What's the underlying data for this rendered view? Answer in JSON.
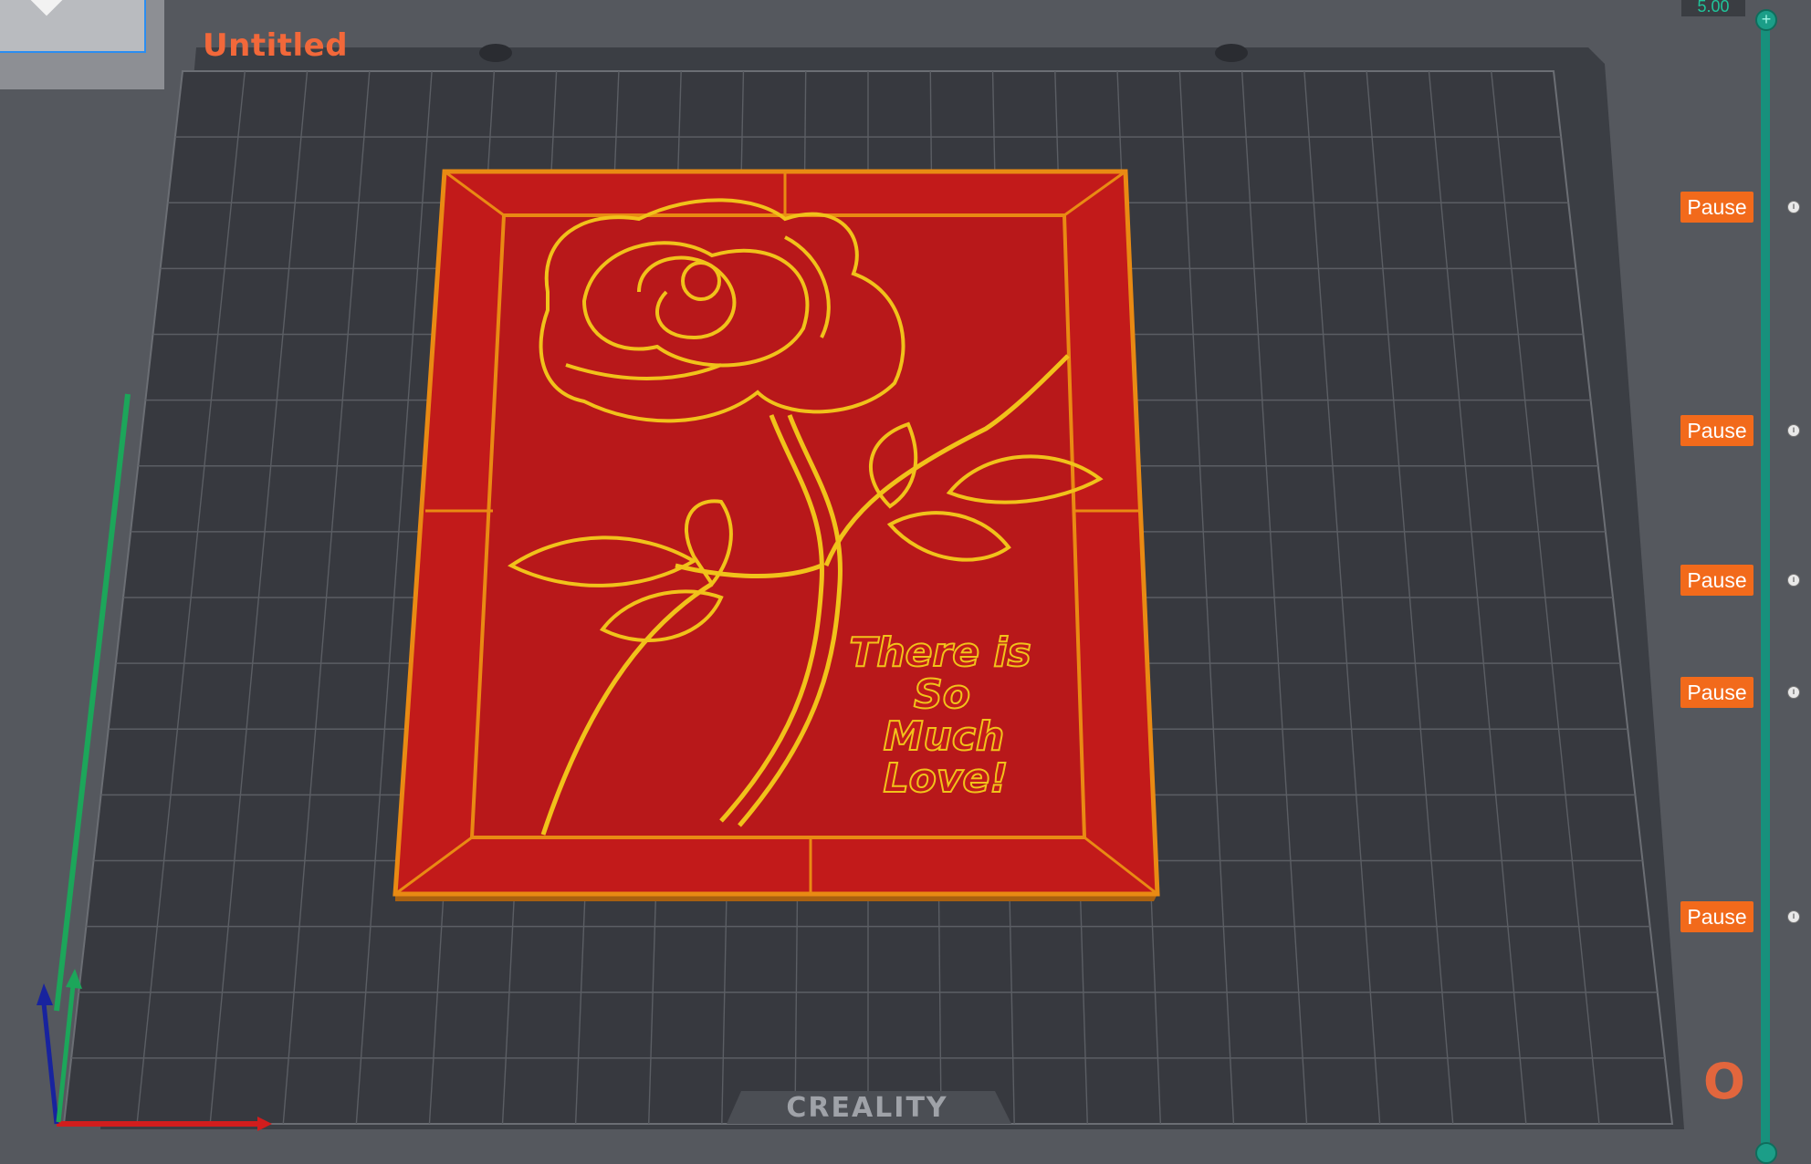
{
  "document": {
    "title": "Untitled"
  },
  "bed": {
    "brand": "CREALITY"
  },
  "model": {
    "text_lines": [
      "There is",
      "So",
      "Much",
      "Love!"
    ],
    "colors": {
      "plate": "#c21a1a",
      "edge": "#e98a13",
      "highlight": "#f1c21a"
    }
  },
  "layer_slider": {
    "top_value": "5.00",
    "pause_labels": [
      "Pause",
      "Pause",
      "Pause",
      "Pause",
      "Pause"
    ],
    "track_color": "#17907c"
  },
  "axes": {
    "x_color": "#d11d1d",
    "y_color": "#1ca65a",
    "z_color": "#18239e"
  },
  "icons": [
    "plus-icon",
    "pause-marker-icon",
    "axis-gizmo-icon",
    "brand-logo-icon"
  ]
}
